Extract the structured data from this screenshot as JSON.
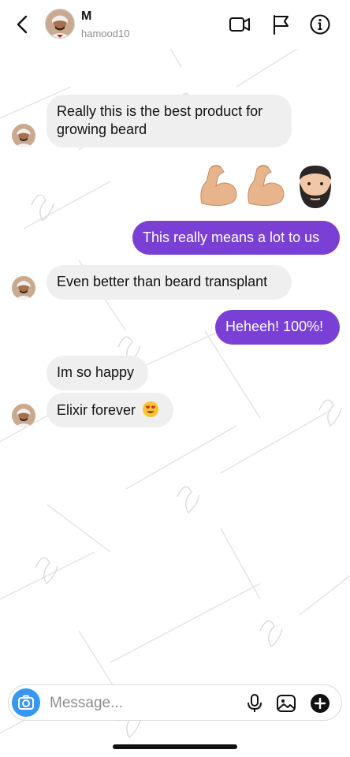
{
  "header": {
    "name": "M",
    "username": "hamood10"
  },
  "messages": [
    {
      "from": "them",
      "text_line1": "Really this is the best product for",
      "text_line2": "growing beard"
    },
    {
      "from": "me",
      "emoji": "flexed-biceps, flexed-biceps, bearded-man"
    },
    {
      "from": "me",
      "text": "This really means a lot to us"
    },
    {
      "from": "them",
      "text": "Even better than beard transplant"
    },
    {
      "from": "me",
      "text": "Heheeh! 100%!"
    },
    {
      "from": "them",
      "text": "Im so happy"
    },
    {
      "from": "them",
      "text": "Elixir forever",
      "emoji": "heart-eyes"
    }
  ],
  "composer": {
    "placeholder": "Message..."
  },
  "colors": {
    "outgoing_bubble": "#7a3fd4",
    "incoming_bubble": "#efefef",
    "camera_button": "#3897f0"
  },
  "icons": [
    "back-arrow-icon",
    "video-call-icon",
    "flag-icon",
    "info-icon",
    "camera-icon",
    "microphone-icon",
    "gallery-icon",
    "plus-icon"
  ]
}
